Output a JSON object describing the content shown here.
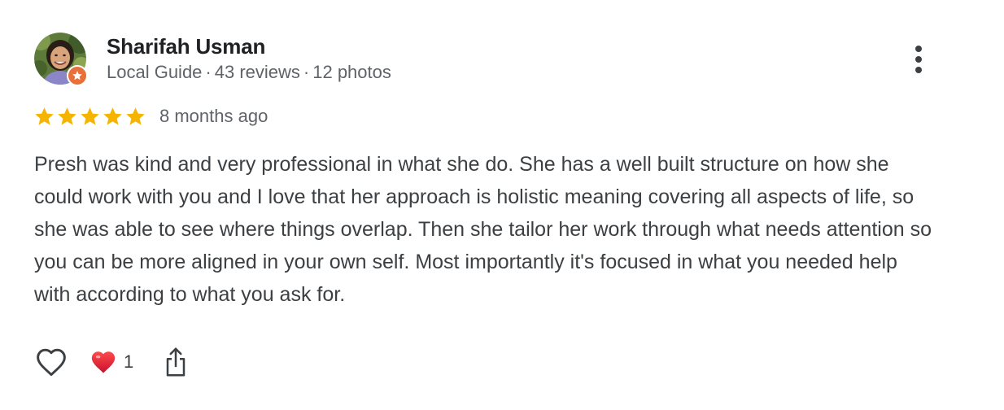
{
  "reviewer": {
    "name": "Sharifah Usman",
    "badge": "Local Guide",
    "reviews": "43 reviews",
    "photos": "12 photos",
    "separator": "·",
    "avatar_icon": "profile-photo",
    "badge_icon": "local-guide-star-icon",
    "badge_color": "#e8703a"
  },
  "rating": {
    "stars": 5,
    "max": 5,
    "star_color": "#f4b400",
    "date": "8 months ago"
  },
  "review": {
    "text": "Presh was kind and very professional in what she do. She has a well built structure on how she could work with you and I love that her approach is holistic meaning covering all aspects of life, so she was able to see where things overlap. Then she tailor her work through what needs attention so you can be more aligned in your own self. Most importantly it's focused in what you needed help with according to what you ask for."
  },
  "actions": {
    "like_icon": "heart-outline-icon",
    "reaction_icon": "red-heart-icon",
    "reaction_count": "1",
    "share_icon": "share-icon",
    "more_icon": "more-vertical-icon"
  },
  "colors": {
    "name": "#202124",
    "meta": "#5f6368",
    "body": "#3c4043",
    "heart_red": "#e0202b"
  }
}
